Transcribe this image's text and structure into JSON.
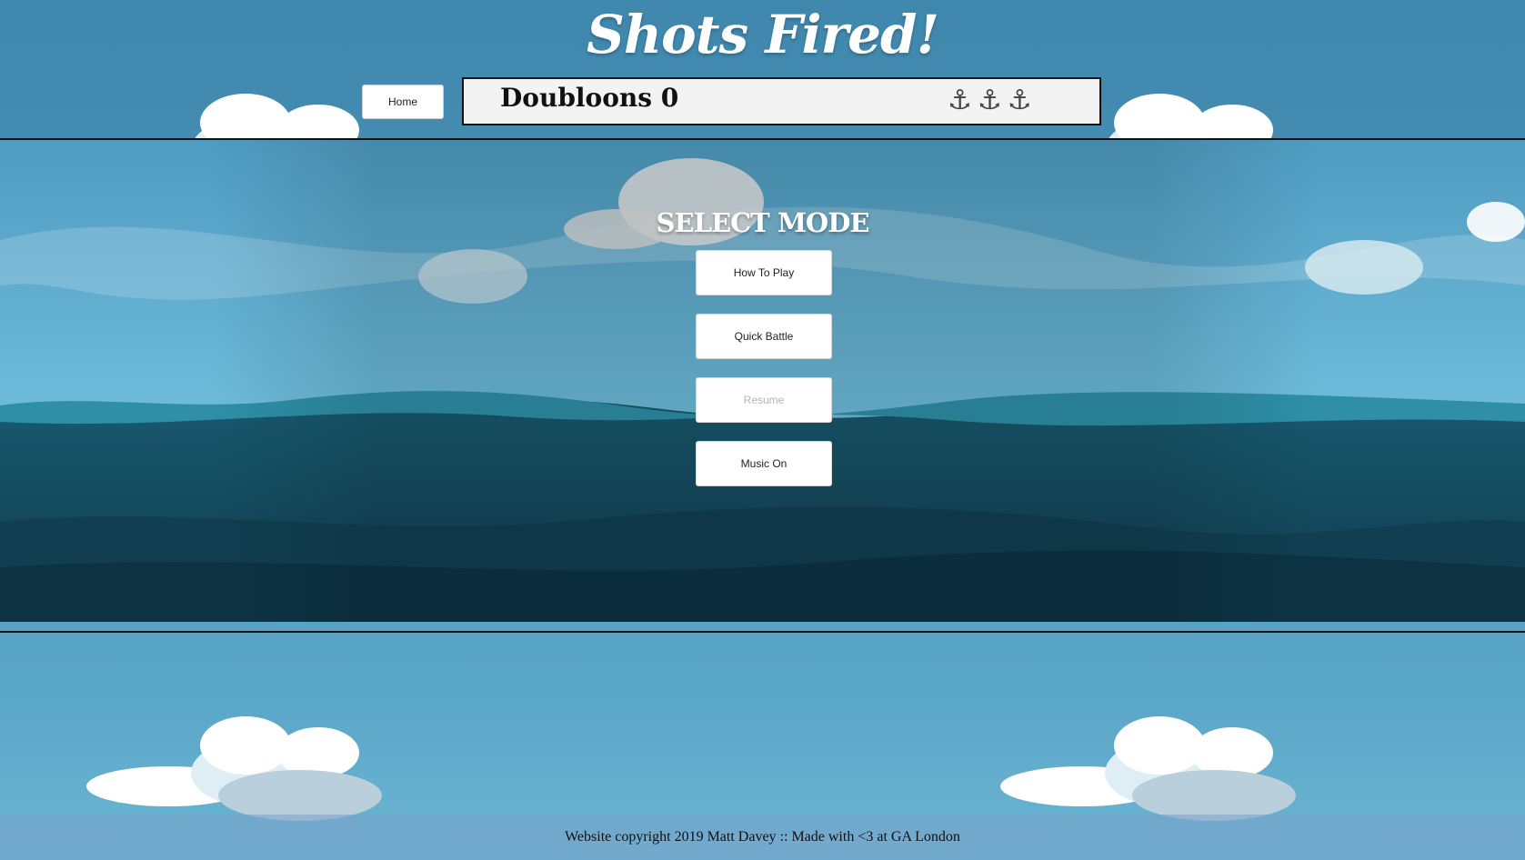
{
  "header": {
    "title": "Shots Fired!",
    "home_label": "Home",
    "score_label": "Doubloons 0",
    "lives_icons": [
      "anchor-icon",
      "anchor-icon",
      "anchor-icon"
    ],
    "lives_text": "⚓⚓⚓"
  },
  "menu": {
    "heading": "SELECT MODE",
    "buttons": [
      {
        "label": "How To Play",
        "enabled": true
      },
      {
        "label": "Quick Battle",
        "enabled": true
      },
      {
        "label": "Resume",
        "enabled": false
      },
      {
        "label": "Music On",
        "enabled": true
      }
    ]
  },
  "footer": {
    "text": "Website copyright 2019 Matt Davey :: Made with <3 at GA London"
  },
  "colors": {
    "sky": "#4b94ba",
    "sea_deep": "#144a5e",
    "sea_light": "#2e8fa6",
    "panel_bg": "#f3f3f3"
  }
}
